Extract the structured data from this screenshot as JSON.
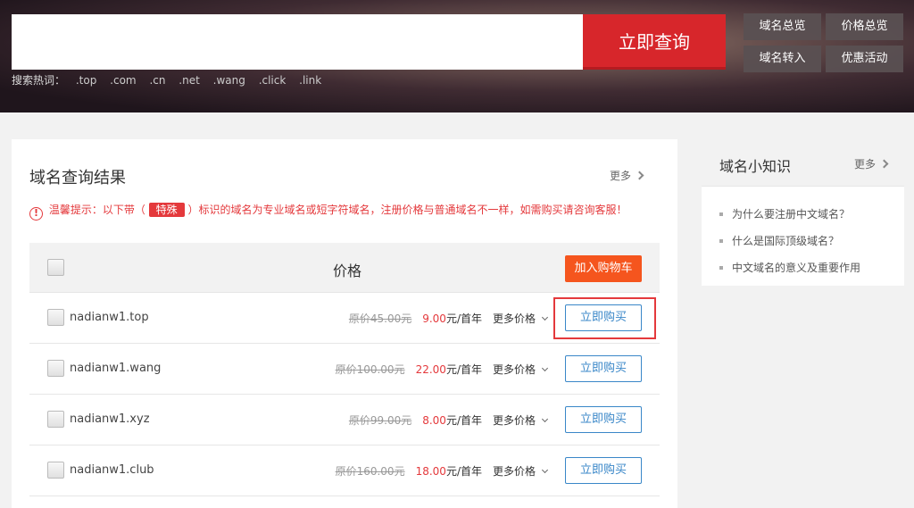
{
  "search": {
    "button_label": "立即查询",
    "hot_label": "搜索热词：",
    "hot_words": [
      ".top",
      ".com",
      ".cn",
      ".net",
      ".wang",
      ".click",
      ".link"
    ]
  },
  "quick_links": [
    "域名总览",
    "价格总览",
    "域名转入",
    "优惠活动"
  ],
  "results": {
    "title": "域名查询结果",
    "more_label": "更多",
    "tip_prefix": "温馨提示：以下带（",
    "tip_tag": "特殊",
    "tip_suffix": "）标识的域名为专业域名或短字符域名，注册价格与普通域名不一样，如需购买请咨询客服！",
    "header_price": "价格",
    "cart_button": "加入购物车",
    "rows": [
      {
        "domain": "nadianw1.top",
        "original": "原价45.00元",
        "price": "9.00",
        "unit": "元/首年",
        "more": "更多价格",
        "buy": "立即购买"
      },
      {
        "domain": "nadianw1.wang",
        "original": "原价100.00元",
        "price": "22.00",
        "unit": "元/首年",
        "more": "更多价格",
        "buy": "立即购买"
      },
      {
        "domain": "nadianw1.xyz",
        "original": "原价99.00元",
        "price": "8.00",
        "unit": "元/首年",
        "more": "更多价格",
        "buy": "立即购买"
      },
      {
        "domain": "nadianw1.club",
        "original": "原价160.00元",
        "price": "18.00",
        "unit": "元/首年",
        "more": "更多价格",
        "buy": "立即购买"
      }
    ]
  },
  "knowledge": {
    "title": "域名小知识",
    "more_label": "更多",
    "items": [
      "为什么要注册中文域名？",
      "什么是国际顶级域名？",
      "中文域名的意义及重要作用"
    ]
  },
  "colors": {
    "accent_red": "#d7262b",
    "cart_orange": "#f5551e",
    "link_blue": "#3a87c8"
  }
}
